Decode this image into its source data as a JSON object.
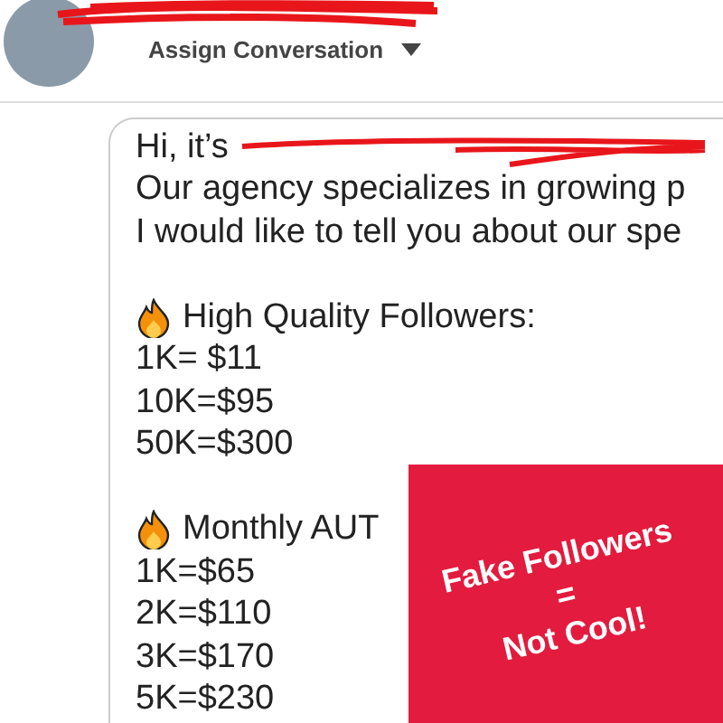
{
  "header": {
    "assign_label": "Assign Conversation"
  },
  "message": {
    "lines": [
      {
        "kind": "redacted",
        "text": "Hi, it’s"
      },
      {
        "kind": "text",
        "text": "Our agency specializes in growing p"
      },
      {
        "kind": "text",
        "text": "I would like to tell you about our spe"
      },
      {
        "kind": "blank"
      },
      {
        "kind": "heading",
        "text": "High Quality Followers:"
      },
      {
        "kind": "text",
        "text": "1K= $11"
      },
      {
        "kind": "text",
        "text": "10K=$95"
      },
      {
        "kind": "text",
        "text": "50K=$300"
      },
      {
        "kind": "blank"
      },
      {
        "kind": "heading",
        "text": "Monthly AUT"
      },
      {
        "kind": "text",
        "text": "1K=$65"
      },
      {
        "kind": "text",
        "text": "2K=$110"
      },
      {
        "kind": "text",
        "text": "3K=$170"
      },
      {
        "kind": "text",
        "text": "5K=$230"
      }
    ]
  },
  "overlay": {
    "lines": [
      "Fake Followers",
      "=",
      "Not Cool!"
    ]
  }
}
